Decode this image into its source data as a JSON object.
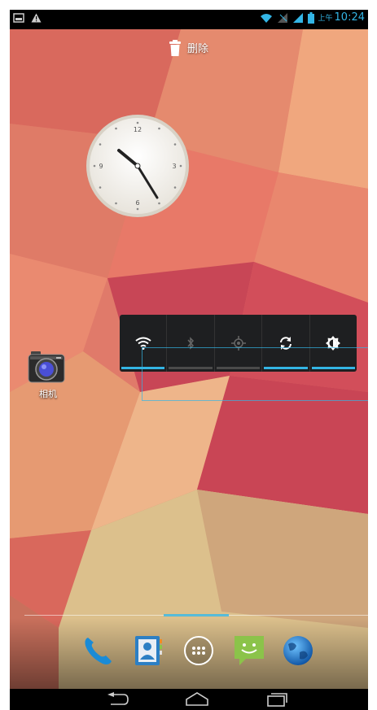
{
  "statusbar": {
    "left_icons": [
      "image-notification-icon",
      "warning-icon"
    ],
    "right_icons": [
      "wifi-icon",
      "no-signal-icon",
      "signal-icon",
      "battery-icon"
    ],
    "ampm": "上午",
    "time": "10:24"
  },
  "drop_target": {
    "icon": "trash-icon",
    "label": "删除"
  },
  "clock": {
    "numerals": [
      "12",
      "3",
      "6",
      "9"
    ]
  },
  "camera_shortcut": {
    "icon": "camera-app-icon",
    "label": "相机"
  },
  "power_widget": {
    "toggles": [
      {
        "name": "wifi",
        "icon": "wifi-toggle-icon",
        "on": true
      },
      {
        "name": "bluetooth",
        "icon": "bluetooth-toggle-icon",
        "on": false
      },
      {
        "name": "location",
        "icon": "location-toggle-icon",
        "on": false
      },
      {
        "name": "sync",
        "icon": "sync-toggle-icon",
        "on": true
      },
      {
        "name": "brightness",
        "icon": "brightness-toggle-icon",
        "on": true
      }
    ],
    "accent": "#33b5e5"
  },
  "dock": {
    "items": [
      "phone-app-icon",
      "contacts-app-icon",
      "all-apps-icon",
      "messaging-app-icon",
      "browser-app-icon"
    ]
  },
  "navbar": {
    "buttons": [
      "back-icon",
      "home-icon",
      "recents-icon"
    ]
  }
}
